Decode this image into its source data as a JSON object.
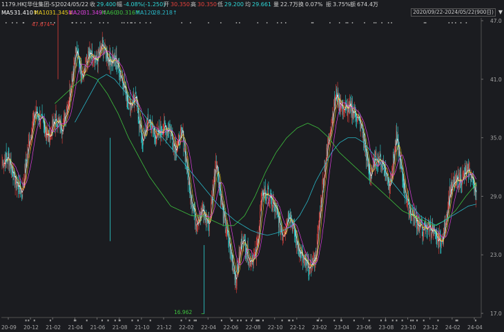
{
  "header": {
    "ticker": "1179.HK[华住集团-S]",
    "date": "2024/05/22",
    "close_label": "收",
    "close": "29.400",
    "change_label": "幅",
    "change": "-4.08%(-1.250)",
    "open_label": "开",
    "open": "30.350",
    "high_label": "高",
    "high": "30.350",
    "low_label": "低",
    "low": "29.200",
    "avg_label": "均",
    "avg": "29.661",
    "volume_label": "量",
    "volume": "22.7万",
    "turnover_label": "换",
    "turnover": "0.07%",
    "amplitude_label": "振",
    "amplitude": "3.75%",
    "amount_label": "额",
    "amount": "674.4万"
  },
  "ma": {
    "ma5_label": "MA5",
    "ma5": "31.410↑",
    "ma10_label": "MA10",
    "ma10": "31.345↓",
    "ma20_label": "MA20",
    "ma20": "31.349↑",
    "ma60_label": "MA60",
    "ma60": "30.316↑",
    "ma120_label": "MA120",
    "ma120": "28.218↑"
  },
  "range": {
    "label": "2020/09/22-2024/05/22(900日)"
  },
  "annotations": {
    "max_label": "47.674→",
    "min_label": "16.962"
  },
  "y_ticks": [
    "47.0",
    "41.0",
    "35.0",
    "29.0",
    "23.0",
    "17.0"
  ],
  "x_ticks": [
    "20-09",
    "20-12",
    "21-02",
    "21-04",
    "21-06",
    "21-08",
    "21-10",
    "21-12",
    "22-02",
    "22-04",
    "22-06",
    "22-08",
    "22-10",
    "22-12",
    "23-02",
    "23-04",
    "23-06",
    "23-08",
    "23-10",
    "23-12",
    "24-02",
    "24-04"
  ],
  "colors": {
    "up": "#e8413b",
    "down": "#2ed8d8",
    "ma5": "#ffffff",
    "ma10": "#f0d020",
    "ma20": "#e040e0",
    "ma60": "#3ec23e",
    "ma120": "#29b8c8",
    "background": "#1b1c20"
  },
  "chart_data": {
    "type": "candlestick",
    "ylim": [
      17.0,
      47.0
    ],
    "y_ticks": [
      47.0,
      41.0,
      35.0,
      29.0,
      23.0,
      17.0
    ],
    "x_categories": [
      "20-09",
      "20-12",
      "21-02",
      "21-04",
      "21-06",
      "21-08",
      "21-10",
      "21-12",
      "22-02",
      "22-04",
      "22-06",
      "22-08",
      "22-10",
      "22-12",
      "23-02",
      "23-04",
      "23-06",
      "23-08",
      "23-10",
      "23-12",
      "24-02",
      "24-04"
    ],
    "close_path": [
      32.5,
      33.0,
      30.5,
      29.5,
      34.5,
      37.8,
      36.5,
      35.0,
      37.0,
      36.0,
      39.0,
      44.0,
      41.5,
      43.5,
      42.5,
      44.5,
      43.0,
      43.0,
      41.0,
      38.5,
      39.0,
      34.5,
      37.0,
      35.0,
      36.0,
      36.0,
      34.0,
      35.5,
      30.0,
      26.5,
      27.5,
      26.0,
      33.0,
      27.5,
      24.0,
      20.5,
      25.0,
      22.5,
      23.0,
      29.5,
      29.0,
      27.5,
      25.0,
      27.5,
      24.5,
      22.5,
      21.5,
      23.0,
      30.5,
      35.5,
      39.5,
      38.0,
      38.0,
      37.5,
      35.5,
      31.0,
      33.0,
      32.5,
      30.0,
      35.0,
      30.5,
      27.5,
      26.5,
      25.5,
      26.0,
      24.5,
      24.5,
      29.5,
      30.5,
      31.0,
      31.5,
      29.4
    ],
    "ma120_path": [
      null,
      null,
      null,
      null,
      null,
      null,
      null,
      null,
      null,
      36.5,
      38.0,
      39.5,
      41.0,
      41.5,
      41.0,
      40.0,
      39.0,
      38.0,
      37.0,
      36.0,
      35.0,
      34.0,
      33.0,
      32.0,
      31.0,
      30.0,
      29.0,
      28.0,
      27.2,
      26.5,
      26.0,
      25.5,
      25.2,
      25.0,
      25.2,
      25.5,
      26.0,
      27.0,
      28.5,
      30.5,
      32.0,
      33.5,
      34.5,
      35.0,
      35.0,
      34.5,
      33.5,
      32.5,
      31.0,
      30.0,
      29.0,
      28.0,
      27.0,
      26.5,
      26.0,
      26.5,
      27.0,
      27.5,
      28.0,
      28.2
    ],
    "ma60_path": [
      null,
      null,
      null,
      null,
      null,
      38.5,
      39.5,
      40.5,
      41.5,
      41.0,
      39.5,
      37.5,
      35.0,
      33.0,
      31.0,
      29.5,
      28.0,
      27.5,
      27.0,
      27.0,
      26.5,
      26.0,
      26.0,
      27.0,
      29.0,
      31.5,
      33.5,
      35.0,
      36.0,
      36.5,
      36.0,
      35.0,
      33.5,
      32.5,
      31.5,
      30.5,
      29.5,
      28.5,
      27.5,
      27.0,
      26.5,
      26.0,
      26.5,
      27.5,
      29.0,
      30.3
    ],
    "min_price": 16.962,
    "max_price": 47.674
  }
}
